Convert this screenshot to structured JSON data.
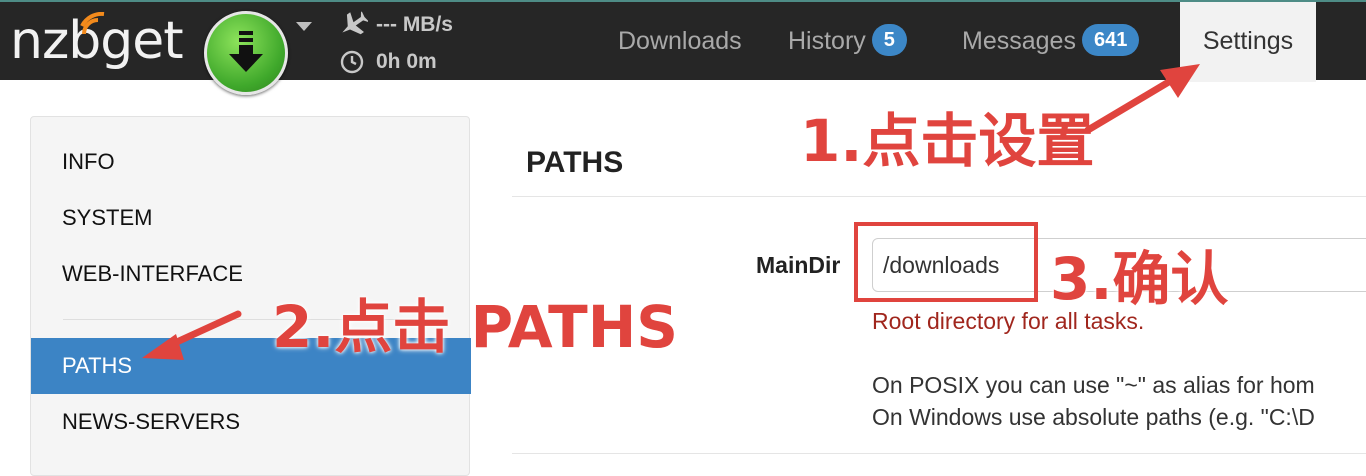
{
  "header": {
    "logo_text": "nzbget",
    "speed": "--- MB/s",
    "time_left": "0h 0m",
    "nav": [
      {
        "label": "Downloads"
      },
      {
        "label": "History",
        "badge": "5"
      },
      {
        "label": "Messages",
        "badge": "641"
      },
      {
        "label": "Settings",
        "active": true
      }
    ],
    "icons": [
      "download-icon",
      "airplane-icon",
      "clock-icon",
      "caret-down-icon"
    ]
  },
  "sidebar": {
    "items": [
      {
        "label": "INFO"
      },
      {
        "label": "SYSTEM"
      },
      {
        "label": "WEB-INTERFACE"
      },
      {
        "label": "PATHS",
        "active": true
      },
      {
        "label": "NEWS-SERVERS"
      }
    ]
  },
  "main": {
    "section_title": "PATHS",
    "field": {
      "label": "MainDir",
      "value": "/downloads",
      "help_red": "Root directory for all tasks.",
      "help_line1": "On POSIX you can use \"~\" as alias for hom",
      "help_line2": "On Windows use absolute paths (e.g. \"C:\\D"
    }
  },
  "annotations": {
    "step1": "1.点击设置",
    "step2": "2.点击 PATHS",
    "step3": "3.确认",
    "color": "#e0443e"
  },
  "colors": {
    "topbar": "#262626",
    "accent": "#3c84c5",
    "badge": "#3c87c7",
    "help_red": "#a0261d"
  }
}
